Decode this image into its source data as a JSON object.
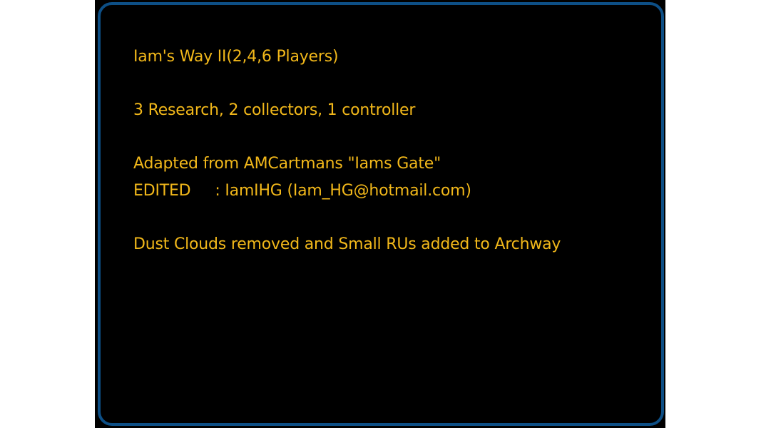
{
  "info": {
    "line1": "Iam's Way II(2,4,6 Players)",
    "line2": "",
    "line3": "3 Research, 2 collectors, 1 controller",
    "line4": "",
    "line5": "Adapted from AMCartmans \"Iams Gate\"",
    "line6": "EDITED     : IamIHG (Iam_HG@hotmail.com)",
    "line7": "",
    "line8": "Dust Clouds removed and Small RUs added to Archway"
  },
  "colors": {
    "text": "#f2b81a",
    "border": "#0d4f86",
    "background": "#000000"
  }
}
